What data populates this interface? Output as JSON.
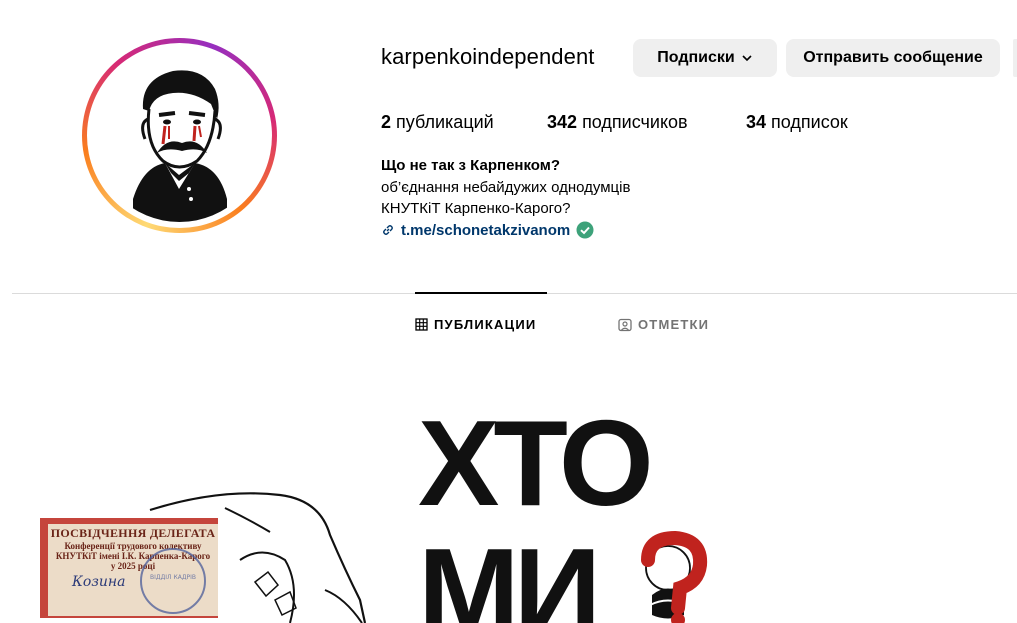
{
  "profile": {
    "username": "karpenkoindependent",
    "following_button": "Подписки",
    "message_button": "Отправить сообщение"
  },
  "stats": {
    "posts_count": "2",
    "posts_label": "публикаций",
    "followers_count": "342",
    "followers_label": "подписчиков",
    "following_count": "34",
    "following_label": "подписок"
  },
  "bio": {
    "name": "Що не так з Карпенком?",
    "line1": "об’єднання небайдужих однодумців",
    "line2": "КНУТКіТ Карпенко-Карого?",
    "link": "t.me/schonetakzivanom"
  },
  "tabs": {
    "posts": "ПУБЛИКАЦИИ",
    "tagged": "ОТМЕТКИ"
  },
  "post": {
    "big_text_line1": "ХТО",
    "big_text_line2": "МИ",
    "card_title": "ПОСВІДЧЕННЯ ДЕЛЕГАТА",
    "card_line1": "Конференції трудового колективу",
    "card_line2": "КНУТКіТ імені І.К. Карпенка-Карого",
    "card_line3": "у 2025 році",
    "card_signature": "Козина",
    "stamp_text": "ВІДДІЛ КАДРІВ"
  },
  "colors": {
    "accent_link": "#00376b",
    "verified": "#3da27a",
    "button_bg": "#efefef",
    "question_mark": "#c0231e"
  },
  "icons": {
    "link": "link-icon",
    "verified": "verified-badge-icon",
    "chevron": "chevron-down-icon",
    "grid": "grid-icon",
    "tagged": "tagged-person-icon"
  }
}
